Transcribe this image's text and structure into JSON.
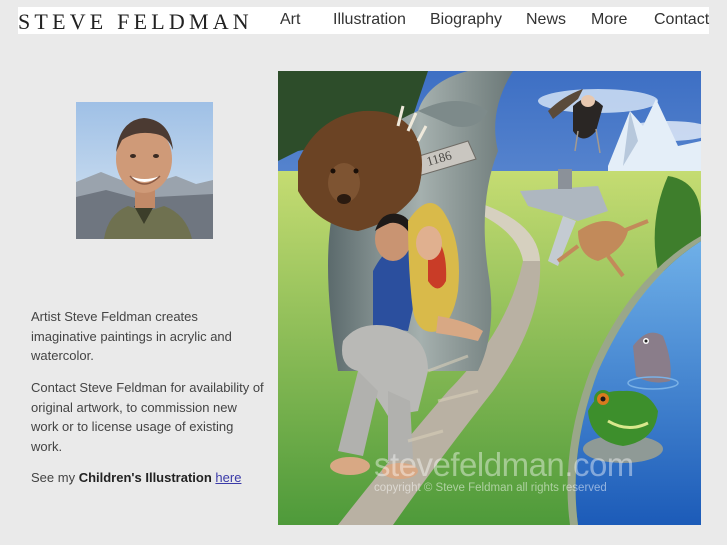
{
  "header": {
    "site_name": "STEVE FELDMAN",
    "nav": [
      {
        "label": "Art"
      },
      {
        "label": "Illustration"
      },
      {
        "label": "Biography"
      },
      {
        "label": "News"
      },
      {
        "label": "More"
      },
      {
        "label": "Contact"
      }
    ]
  },
  "intro": {
    "para1": "Artist Steve Feldman creates imaginative paintings in acrylic and watercolor.",
    "para2": "Contact Steve Feldman for availability of original artwork, to commission new work or to license usage of existing work.",
    "para3_prefix": "See my ",
    "para3_bold": "Children's Illustration",
    "para3_link": "here"
  },
  "painting": {
    "sign": "1186",
    "watermark": "stevefeldman.com",
    "copyright": "copyright © Steve Feldman all rights reserved"
  },
  "colors": {
    "page_bg": "#eaeaea",
    "header_bg": "#ffffff",
    "link": "#3a3aa8"
  }
}
